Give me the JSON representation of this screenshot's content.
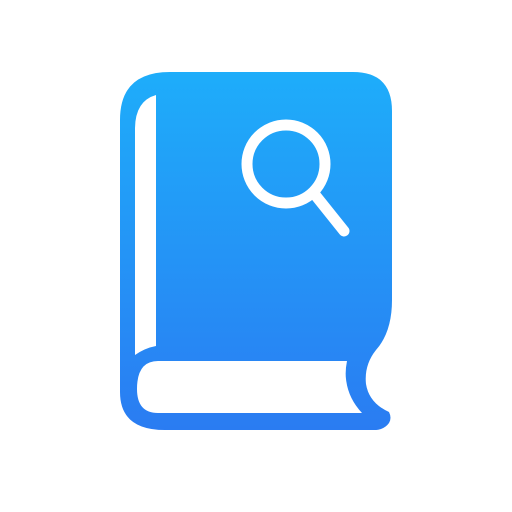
{
  "icon": {
    "name": "book-search-icon",
    "colors": {
      "gradient_top": "#1EADFA",
      "gradient_bottom": "#2A7CF2",
      "foreground": "#FFFFFF",
      "background": "#FFFFFF"
    }
  }
}
